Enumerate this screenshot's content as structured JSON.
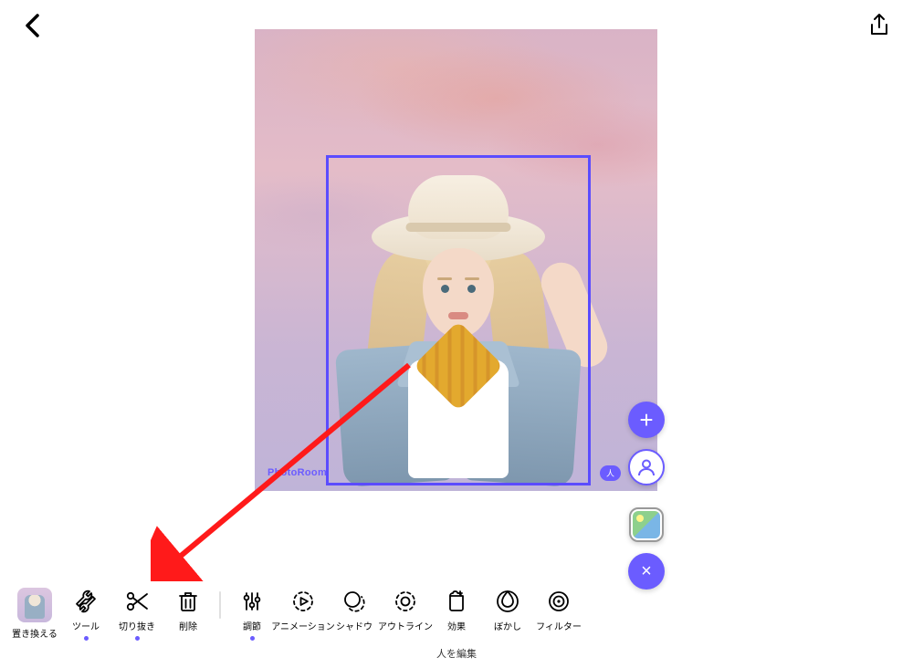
{
  "header": {
    "back_icon": "chevron-left",
    "share_icon": "share"
  },
  "canvas": {
    "watermark": "PhotoRoom",
    "selection_color": "#5b4cff"
  },
  "layer_panel": {
    "add_label": "+",
    "person_badge": "人",
    "close_label": "×"
  },
  "toolbar": {
    "items": [
      {
        "id": "replace",
        "label": "置き換える",
        "kind": "thumb"
      },
      {
        "id": "tools",
        "label": "ツール",
        "icon": "wrench",
        "dot": true
      },
      {
        "id": "cutout",
        "label": "切り抜き",
        "icon": "scissors",
        "dot": true
      },
      {
        "id": "delete",
        "label": "削除",
        "icon": "trash"
      },
      {
        "id": "sep",
        "kind": "sep"
      },
      {
        "id": "adjust",
        "label": "調節",
        "icon": "sliders",
        "dot": true
      },
      {
        "id": "animation",
        "label": "アニメーション",
        "icon": "anim"
      },
      {
        "id": "shadow",
        "label": "シャドウ",
        "icon": "shadow"
      },
      {
        "id": "outline",
        "label": "アウトライン",
        "icon": "outline"
      },
      {
        "id": "effect",
        "label": "効果",
        "icon": "effect"
      },
      {
        "id": "blur",
        "label": "ぼかし",
        "icon": "blur"
      },
      {
        "id": "filter",
        "label": "フィルター",
        "icon": "filter"
      }
    ]
  },
  "status_text": "人を編集",
  "annotation": {
    "arrow_color": "#ff1a1a"
  }
}
